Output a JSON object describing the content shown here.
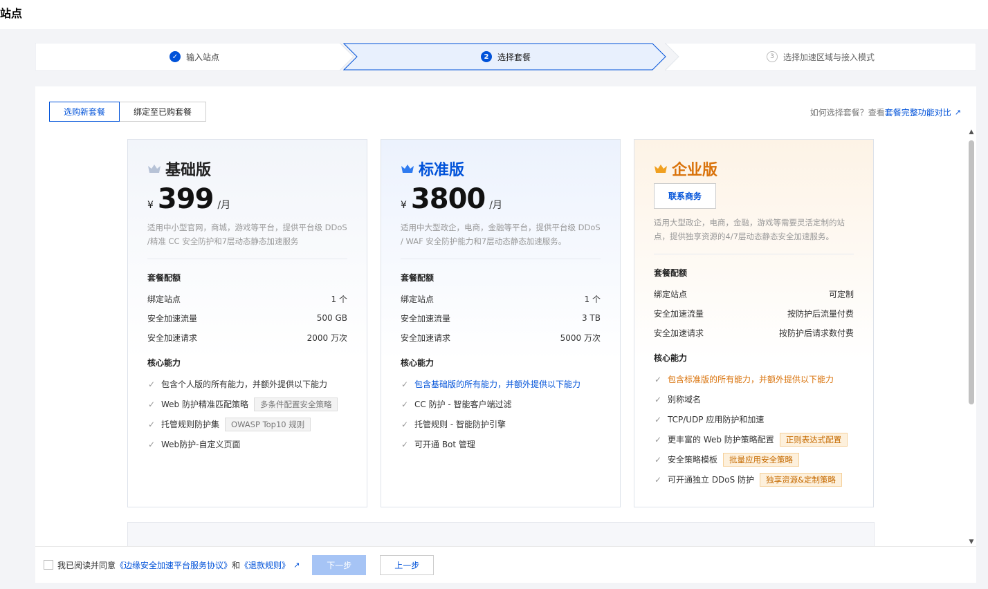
{
  "page": {
    "title": "站点"
  },
  "steps": [
    {
      "label": "输入站点",
      "state": "done"
    },
    {
      "label": "选择套餐",
      "state": "active",
      "index": "2"
    },
    {
      "label": "选择加速区域与接入模式",
      "state": "todo",
      "index": "3"
    }
  ],
  "tabs": [
    {
      "label": "选购新套餐",
      "active": true
    },
    {
      "label": "绑定至已购套餐",
      "active": false
    }
  ],
  "help": {
    "prefix": "如何选择套餐？查看",
    "link": "套餐完整功能对比"
  },
  "plans": [
    {
      "name": "基础版",
      "currency": "¥",
      "price": "399",
      "unit": "/月",
      "desc": "适用中小型官网，商城，游戏等平台，提供平台级 DDoS /精准 CC 安全防护和7层动态静态加速服务",
      "quota_title": "套餐配额",
      "quota": [
        {
          "label": "绑定站点",
          "value": "1 个"
        },
        {
          "label": "安全加速流量",
          "value": "500 GB"
        },
        {
          "label": "安全加速请求",
          "value": "2000 万次"
        }
      ],
      "core_title": "核心能力",
      "features": [
        {
          "text": "包含个人版的所有能力，并额外提供以下能力",
          "tag": ""
        },
        {
          "text": "Web 防护精准匹配策略",
          "tag": "多条件配置安全策略"
        },
        {
          "text": "托管规则防护集",
          "tag": "OWASP Top10 规则"
        },
        {
          "text": "Web防护-自定义页面",
          "tag": ""
        }
      ]
    },
    {
      "name": "标准版",
      "currency": "¥",
      "price": "3800",
      "unit": "/月",
      "desc": "适用中大型政企，电商，金融等平台，提供平台级 DDoS / WAF 安全防护能力和7层动态静态加速服务。",
      "quota_title": "套餐配额",
      "quota": [
        {
          "label": "绑定站点",
          "value": "1 个"
        },
        {
          "label": "安全加速流量",
          "value": "3 TB"
        },
        {
          "label": "安全加速请求",
          "value": "5000 万次"
        }
      ],
      "core_title": "核心能力",
      "features": [
        {
          "text": "包含基础版的所有能力，并额外提供以下能力",
          "tag": ""
        },
        {
          "text": "CC 防护 - 智能客户端过滤",
          "tag": ""
        },
        {
          "text": "托管规则 - 智能防护引擎",
          "tag": ""
        },
        {
          "text": "可开通 Bot 管理",
          "tag": ""
        }
      ]
    },
    {
      "name": "企业版",
      "contact": "联系商务",
      "desc": "适用大型政企，电商，金融，游戏等需要灵活定制的站点，提供独享资源的4/7层动态静态安全加速服务。",
      "quota_title": "套餐配额",
      "quota": [
        {
          "label": "绑定站点",
          "value": "可定制"
        },
        {
          "label": "安全加速流量",
          "value": "按防护后流量付费"
        },
        {
          "label": "安全加速请求",
          "value": "按防护后请求数付费"
        }
      ],
      "core_title": "核心能力",
      "features": [
        {
          "text": "包含标准版的所有能力，并额外提供以下能力",
          "tag": ""
        },
        {
          "text": "别称域名",
          "tag": ""
        },
        {
          "text": "TCP/UDP 应用防护和加速",
          "tag": ""
        },
        {
          "text": "更丰富的 Web 防护策略配置",
          "tag": "正则表达式配置"
        },
        {
          "text": "安全策略模板",
          "tag": "批量应用安全策略"
        },
        {
          "text": "可开通独立 DDoS 防护",
          "tag": "独享资源&定制策略"
        }
      ]
    }
  ],
  "footer": {
    "agree_prefix": "我已阅读并同意",
    "link1": "《边缘安全加速平台服务协议》",
    "and": "和",
    "link2": "《退款规则》",
    "next": "下一步",
    "prev": "上一步"
  },
  "colors": {
    "accent": "#0052d9",
    "orange": "#d9720a"
  }
}
